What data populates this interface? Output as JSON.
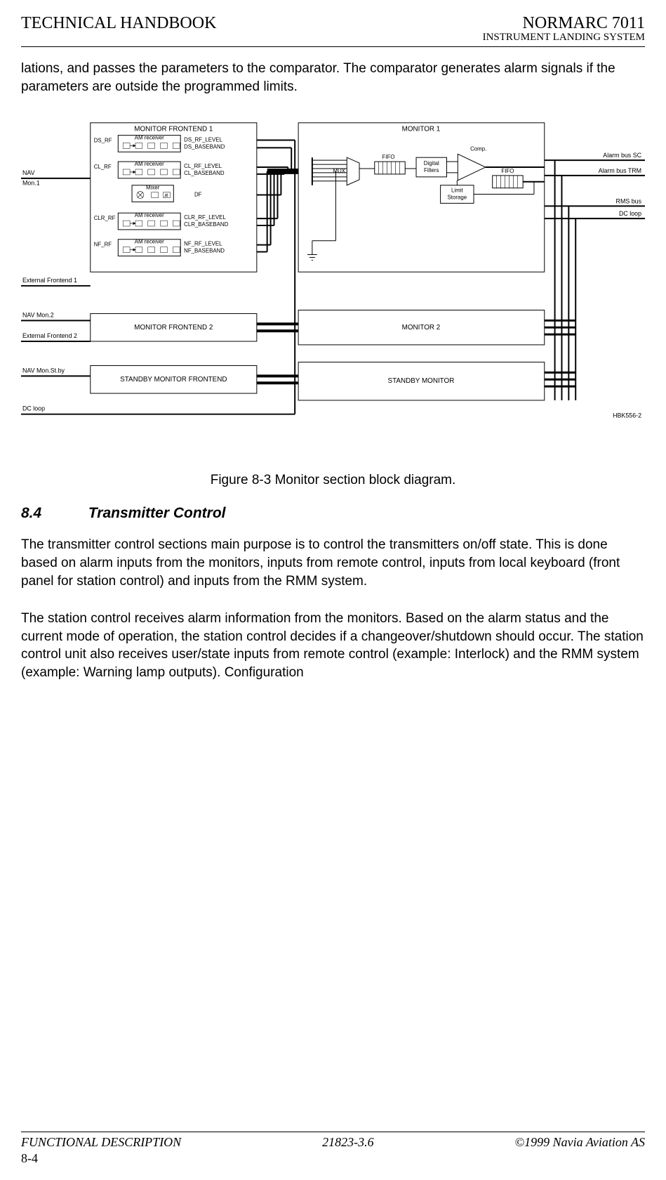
{
  "header": {
    "left": "TECHNICAL HANDBOOK",
    "right": "NORMARC 7011",
    "sub": "INSTRUMENT LANDING SYSTEM"
  },
  "intro_para": "lations, and passes the parameters to the comparator. The comparator generates alarm signals if the parameters are outside the programmed limits.",
  "figure_caption": "Figure 8-3 Monitor section block diagram.",
  "section": {
    "num": "8.4",
    "title": "Transmitter Control"
  },
  "para1": "The transmitter control sections main purpose is to control the transmitters on/off state. This is done based on alarm inputs from the monitors, inputs from remote control, inputs from local keyboard (front panel for station control) and inputs from the RMM system.",
  "para2": "The station control receives alarm information from the monitors. Based on the alarm status and the current mode of operation, the station control decides if a changeover/shutdown should occur. The station control unit also receives user/state inputs from remote control (example: Interlock) and the RMM system (example: Warning lamp outputs). Configuration",
  "footer": {
    "left": "FUNCTIONAL DESCRIPTION",
    "center": "21823-3.6",
    "right": "©1999 Navia Aviation AS",
    "page": "8-4"
  },
  "diagram": {
    "blocks": {
      "mfe1": "MONITOR FRONTEND 1",
      "mfe2": "MONITOR FRONTEND 2",
      "smfe": "STANDBY MONITOR FRONTEND",
      "mon1": "MONITOR 1",
      "mon2": "MONITOR 2",
      "smon": "STANDBY MONITOR"
    },
    "am_rx": "AM receiver",
    "mixer": "Mixer",
    "mux": "MUX",
    "fifo": "FIFO",
    "dfilt": {
      "l1": "Digital",
      "l2": "Filters"
    },
    "comp": "Comp.",
    "limit": {
      "l1": "Limit",
      "l2": "Storage"
    },
    "left_labels": {
      "nav": "NAV",
      "mon1": "Mon.1",
      "ef1": "External Frontend 1",
      "navmon2": "NAV Mon.2",
      "ef2": "External Frontend 2",
      "navstby": "NAV Mon.St.by",
      "dcloop": "DC loop"
    },
    "inputs": {
      "ds": "DS_RF",
      "cl": "CL_RF",
      "clr": "CLR_RF",
      "nf": "NF_RF"
    },
    "outputs": {
      "ds_lvl": "DS_RF_LEVEL",
      "ds_bb": "DS_BASEBAND",
      "cl_lvl": "CL_RF_LEVEL",
      "cl_bb": "CL_BASEBAND",
      "df": "DF",
      "clr_lvl": "CLR_RF_LEVEL",
      "clr_bb": "CLR_BASEBAND",
      "nf_lvl": "NF_RF_LEVEL",
      "nf_bb": "NF_BASEBAND"
    },
    "right_labels": {
      "abus_sc": "Alarm bus SC",
      "abus_trm": "Alarm bus TRM",
      "rms": "RMS bus",
      "dcloop": "DC loop",
      "hbk": "HBK556-2"
    }
  },
  "chart_data": {
    "type": "diagram",
    "title": "Monitor section block diagram",
    "left_inputs": [
      {
        "name": "NAV Mon.1",
        "to": "MONITOR FRONTEND 1"
      },
      {
        "name": "External Frontend 1",
        "to": "MONITOR FRONTEND 1"
      },
      {
        "name": "NAV Mon.2",
        "to": "MONITOR FRONTEND 2"
      },
      {
        "name": "External Frontend 2",
        "to": "MONITOR FRONTEND 2"
      },
      {
        "name": "NAV Mon.St.by",
        "to": "STANDBY MONITOR FRONTEND"
      },
      {
        "name": "DC loop",
        "to": "chain"
      }
    ],
    "frontend1_channels": [
      {
        "rf_in": "DS_RF",
        "block": "AM receiver",
        "outputs": [
          "DS_RF_LEVEL",
          "DS_BASEBAND"
        ]
      },
      {
        "rf_in": "CL_RF",
        "block": "AM receiver",
        "outputs": [
          "CL_RF_LEVEL",
          "CL_BASEBAND"
        ]
      },
      {
        "rf_in": null,
        "block": "Mixer",
        "outputs": [
          "DF"
        ]
      },
      {
        "rf_in": "CLR_RF",
        "block": "AM receiver",
        "outputs": [
          "CLR_RF_LEVEL",
          "CLR_BASEBAND"
        ]
      },
      {
        "rf_in": "NF_RF",
        "block": "AM receiver",
        "outputs": [
          "NF_RF_LEVEL",
          "NF_BASEBAND"
        ]
      }
    ],
    "monitor1_chain": [
      "MUX",
      "FIFO",
      "Digital Filters",
      "Comp.",
      "FIFO"
    ],
    "monitor1_aux": [
      "Limit Storage"
    ],
    "right_buses": [
      "Alarm bus SC",
      "Alarm bus TRM",
      "RMS bus",
      "DC loop"
    ],
    "frontends": [
      "MONITOR FRONTEND 1",
      "MONITOR FRONTEND 2",
      "STANDBY MONITOR FRONTEND"
    ],
    "monitors": [
      "MONITOR 1",
      "MONITOR 2",
      "STANDBY MONITOR"
    ],
    "note": "HBK556-2"
  }
}
